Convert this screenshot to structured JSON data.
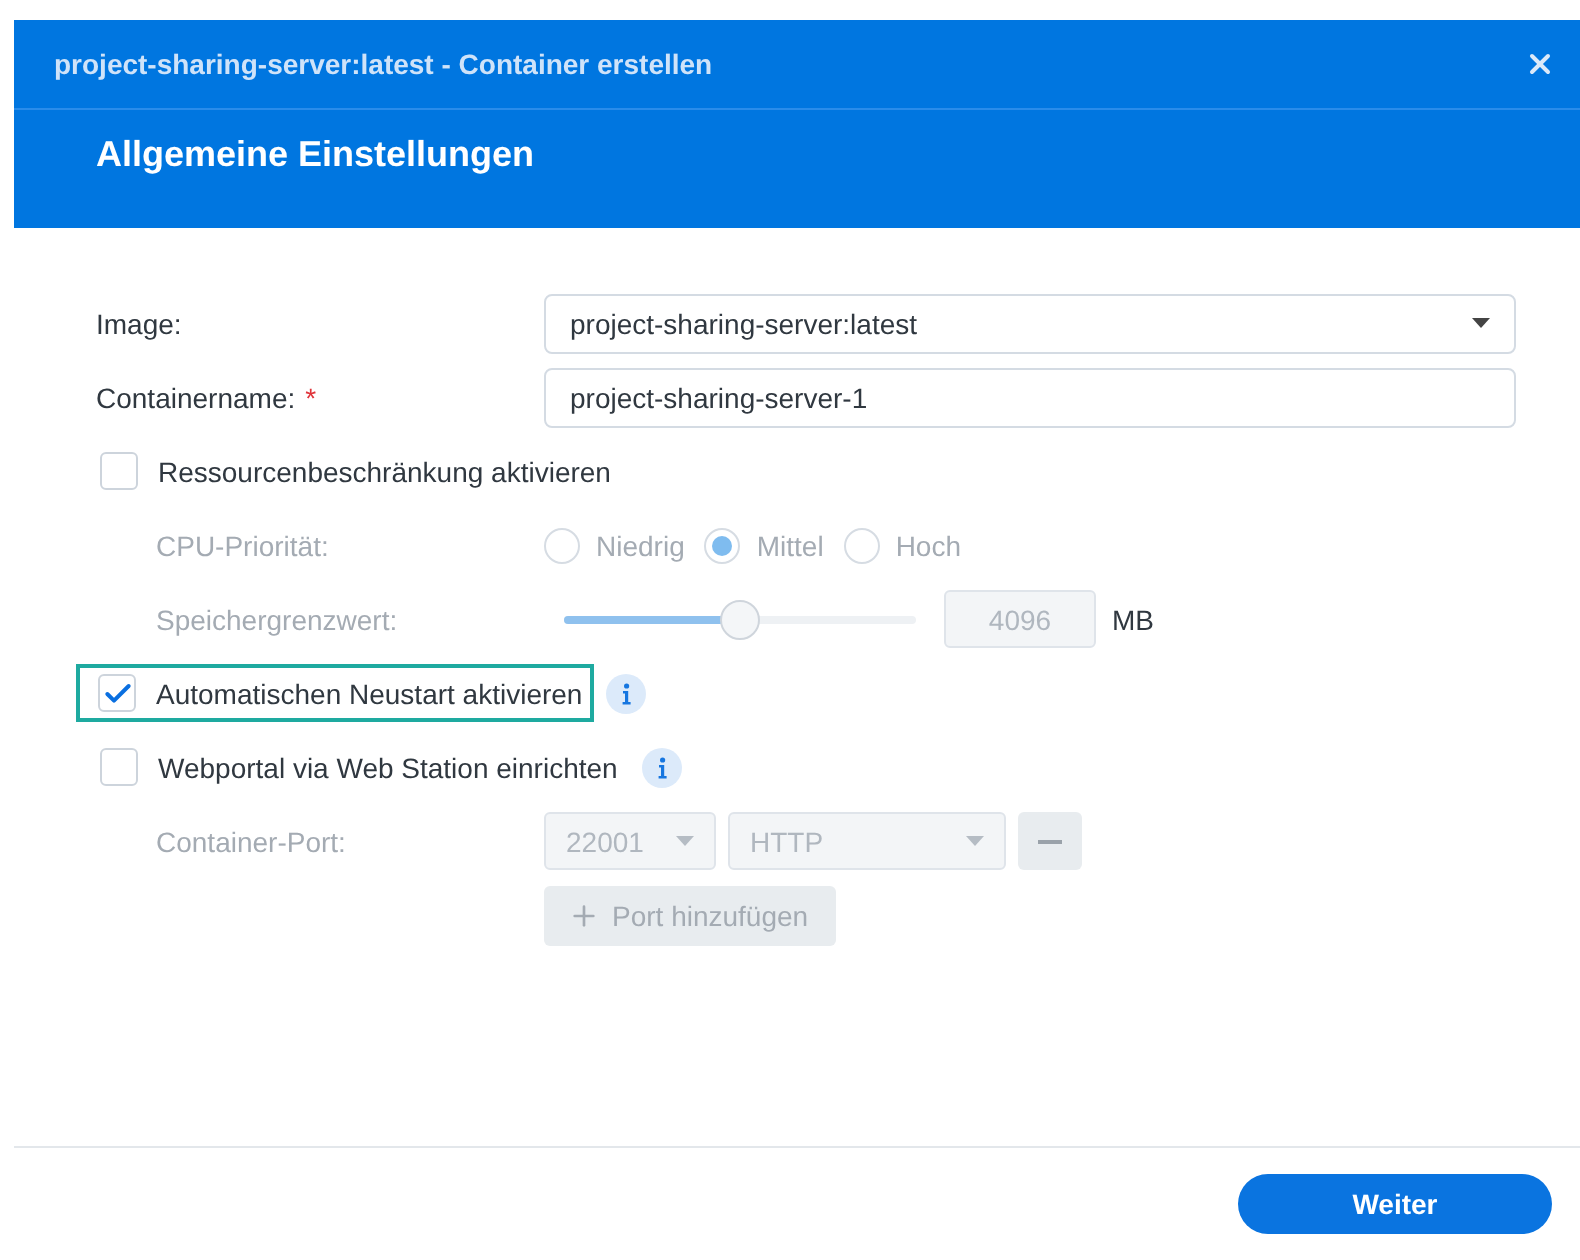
{
  "dialog": {
    "title": "project-sharing-server:latest - Container erstellen",
    "heading": "Allgemeine Einstellungen"
  },
  "fields": [
    {
      "kind": "select",
      "label": "Image:",
      "value": "project-sharing-server:latest"
    },
    {
      "kind": "text",
      "label": "Containername:",
      "required_mark": "*",
      "value": "project-sharing-server-1"
    }
  ],
  "resource_limit": {
    "label": "Ressourcenbeschränkung aktivieren",
    "checked": false,
    "cpu": {
      "label": "CPU-Priorität:",
      "options": [
        {
          "label": "Niedrig",
          "selected": false
        },
        {
          "label": "Mittel",
          "selected": true
        },
        {
          "label": "Hoch",
          "selected": false
        }
      ]
    },
    "memory": {
      "label": "Speichergrenzwert:",
      "level": 0.5,
      "value": "4096",
      "unit": "MB"
    }
  },
  "auto_restart": {
    "label": "Automatischen Neustart aktivieren",
    "checked": true,
    "highlighted": true
  },
  "web_portal": {
    "label": "Webportal via Web Station einrichten",
    "checked": false,
    "port": {
      "label": "Container-Port:",
      "port": "22001",
      "protocol": "HTTP",
      "add_button": "Port hinzufügen"
    }
  },
  "footer": {
    "next_button": "Weiter"
  }
}
